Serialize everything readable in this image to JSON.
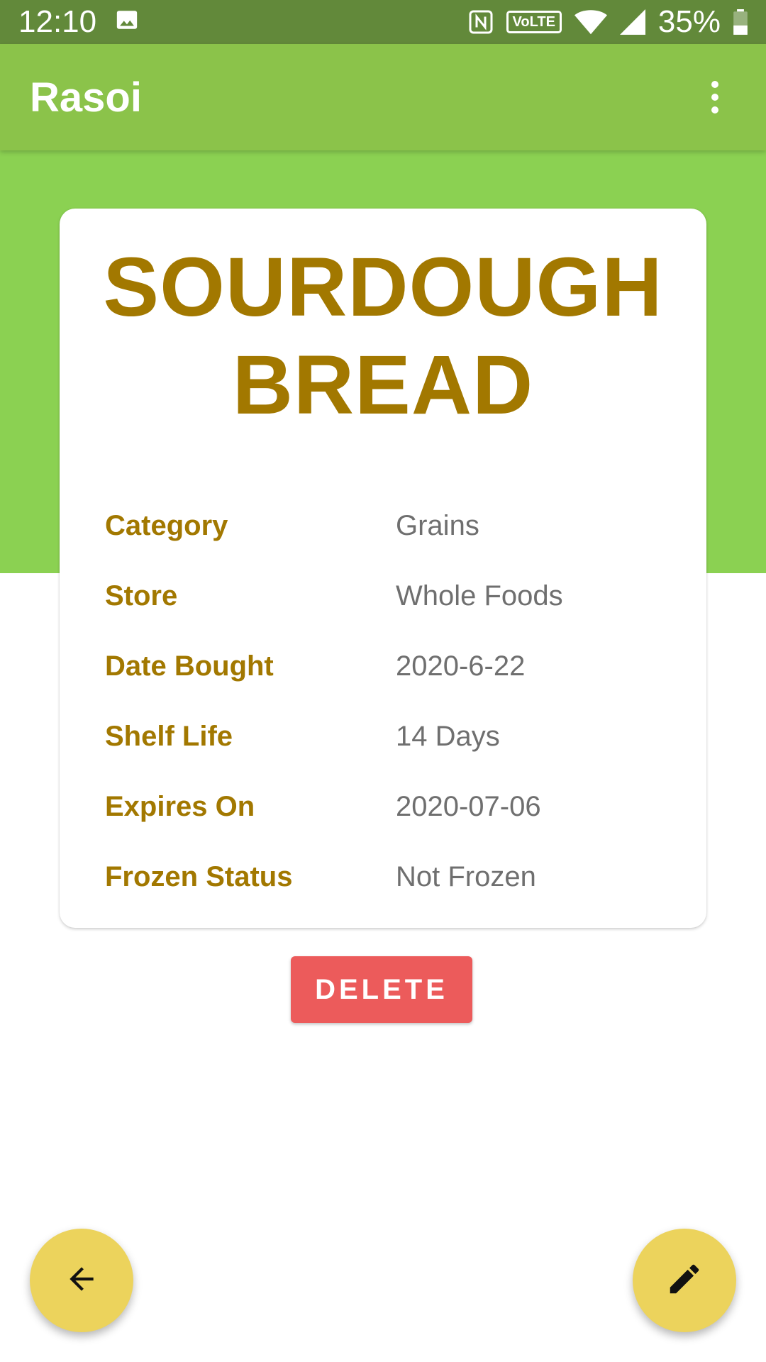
{
  "status_bar": {
    "time": "12:10",
    "volte": "VoLTE",
    "battery": "35%"
  },
  "app_bar": {
    "title": "Rasoi"
  },
  "item": {
    "name": "SOURDOUGH BREAD",
    "details": [
      {
        "label": "Category",
        "value": "Grains"
      },
      {
        "label": "Store",
        "value": "Whole Foods"
      },
      {
        "label": "Date Bought",
        "value": "2020-6-22"
      },
      {
        "label": "Shelf Life",
        "value": "14 Days"
      },
      {
        "label": "Expires On",
        "value": "2020-07-06"
      },
      {
        "label": "Frozen Status",
        "value": "Not Frozen"
      }
    ]
  },
  "actions": {
    "delete_label": "DELETE",
    "back_icon": "arrow-back-icon",
    "edit_icon": "pencil-icon"
  },
  "colors": {
    "app_bar": "#8bc34a",
    "status_bar": "#62893a",
    "hero": "#8bd152",
    "accent_text": "#a27800",
    "delete": "#ec5b5b",
    "fab": "#ecd35c"
  }
}
